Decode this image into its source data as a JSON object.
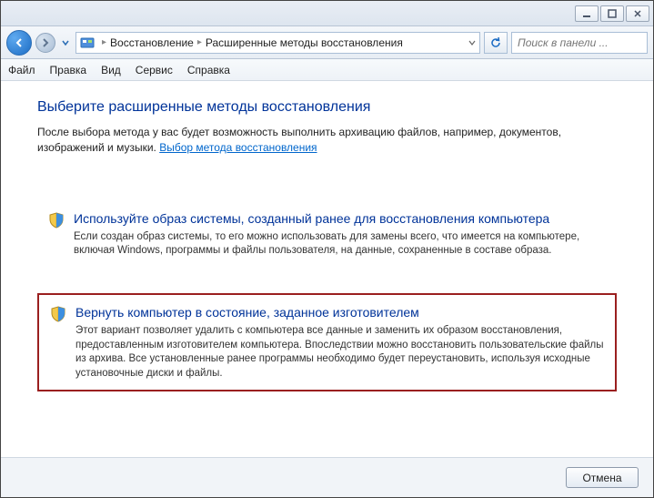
{
  "titlebar": {
    "minimize_tooltip": "Свернуть",
    "maximize_tooltip": "Развернуть",
    "close_tooltip": "Закрыть"
  },
  "breadcrumb": {
    "segment1": "Восстановление",
    "segment2": "Расширенные методы восстановления"
  },
  "search": {
    "placeholder": "Поиск в панели ..."
  },
  "menu": {
    "file": "Файл",
    "edit": "Правка",
    "view": "Вид",
    "tools": "Сервис",
    "help": "Справка"
  },
  "heading": "Выберите расширенные методы восстановления",
  "lead_text": "После выбора метода у вас будет возможность выполнить архивацию файлов, например, документов, изображений и музыки. ",
  "lead_link": "Выбор метода восстановления",
  "options": [
    {
      "title": "Используйте образ системы, созданный ранее для восстановления компьютера",
      "desc": "Если создан образ системы, то его можно использовать для замены всего, что имеется на компьютере, включая Windows, программы и файлы пользователя, на данные, сохраненные в составе образа."
    },
    {
      "title": "Вернуть компьютер в состояние, заданное изготовителем",
      "desc": "Этот вариант позволяет удалить с компьютера все данные и заменить их образом восстановления, предоставленным изготовителем компьютера. Впоследствии можно восстановить пользовательские файлы из архива. Все установленные ранее программы необходимо будет переустановить, используя исходные установочные диски и файлы."
    }
  ],
  "footer": {
    "cancel": "Отмена"
  }
}
